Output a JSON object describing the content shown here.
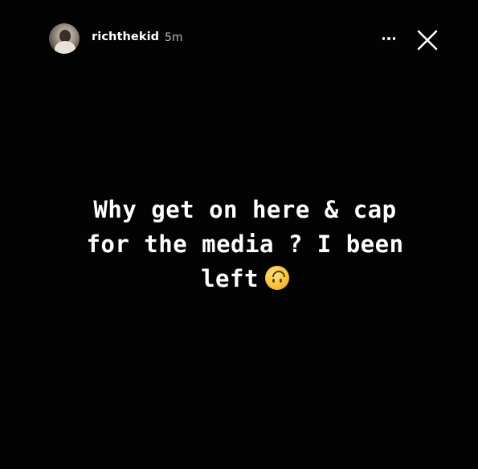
{
  "header": {
    "username": "richthekid",
    "timestamp": "5m",
    "avatar_icon": "profile-photo",
    "more_icon": "more-horizontal-icon",
    "close_icon": "close-icon"
  },
  "story": {
    "caption_line1": "Why get on here & cap",
    "caption_line2": "for the media ? I been",
    "caption_line3": "left",
    "emoji_icon": "upside-down-face-emoji",
    "background_color": "#030303"
  }
}
